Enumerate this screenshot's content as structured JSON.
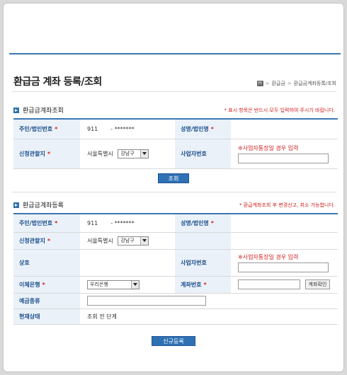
{
  "page": {
    "title": "환급금 계좌 등록/조회",
    "breadcrumb": {
      "home_glyph": "H",
      "items": [
        "환급금",
        "환급금계좌등록/조회"
      ]
    }
  },
  "inquiry": {
    "heading": "환급금계좌조회",
    "notice": "* 표시 항목은 반드시 모두 입력하여 주시기 바랍니다.",
    "id_label": "주민/법인번호",
    "id_front": "911",
    "id_back": "- *******",
    "name_label": "성명/법인명",
    "office_label": "신청관할지",
    "office_city": "서울특별시",
    "office_district": "강남구",
    "bizno_label": "사업자번호",
    "bizno_hint": "※사업자통장일 경우 입력",
    "submit": "조회"
  },
  "register": {
    "heading": "환급금계좌등록",
    "notice": "* 환급계좌조회 후 변경신고, 취소 가능합니다.",
    "id_label": "주민/법인번호",
    "id_front": "911",
    "id_back": "- *******",
    "name_label": "성명/법인명",
    "office_label": "신청관할지",
    "office_city": "서울특별시",
    "office_district": "강남구",
    "company_label": "상호",
    "bizno_label": "사업자번호",
    "bizno_hint": "※사업자통장일 경우 입력",
    "bank_label": "이체은행",
    "bank_value": "우리은행",
    "account_label": "계좌번호",
    "account_check": "계좌확인",
    "deposit_label": "예금종류",
    "status_label": "현재상태",
    "status_value": "조회 전 단계",
    "submit": "신규등록"
  },
  "colors": {
    "accent": "#2f71b5",
    "label_bg": "#eaf1f8",
    "required": "#d32020"
  }
}
